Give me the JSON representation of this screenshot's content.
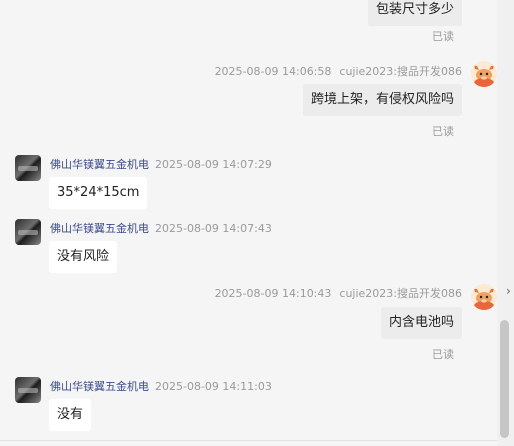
{
  "messages": [
    {
      "direction": "out",
      "text": "包装尺寸多少",
      "read": "已读"
    },
    {
      "direction": "out",
      "sender": "cujie2023:搜品开发086",
      "time": "2025-08-09 14:06:58",
      "text": "跨境上架，有侵权风险吗",
      "read": "已读"
    },
    {
      "direction": "in",
      "sender": "佛山华镁翼五金机电",
      "time": "2025-08-09 14:07:29",
      "text": "35*24*15cm"
    },
    {
      "direction": "in",
      "sender": "佛山华镁翼五金机电",
      "time": "2025-08-09 14:07:43",
      "text": "没有风险"
    },
    {
      "direction": "out",
      "sender": "cujie2023:搜品开发086",
      "time": "2025-08-09 14:10:43",
      "text": "内含电池吗",
      "read": "已读"
    },
    {
      "direction": "in",
      "sender": "佛山华镁翼五金机电",
      "time": "2025-08-09 14:11:03",
      "text": "没有"
    }
  ],
  "icons": {
    "supplier_avatar": "product-thumbnail-avatar",
    "user_avatar": "cartoon-bull-avatar",
    "side_arrow": "chevron-right-icon"
  },
  "colors": {
    "sender_name": "#3b4a8c",
    "meta_text": "#9a9a9a",
    "incoming_bubble": "#ffffff",
    "outgoing_bubble": "#ececec",
    "background": "#f5f5f5"
  }
}
